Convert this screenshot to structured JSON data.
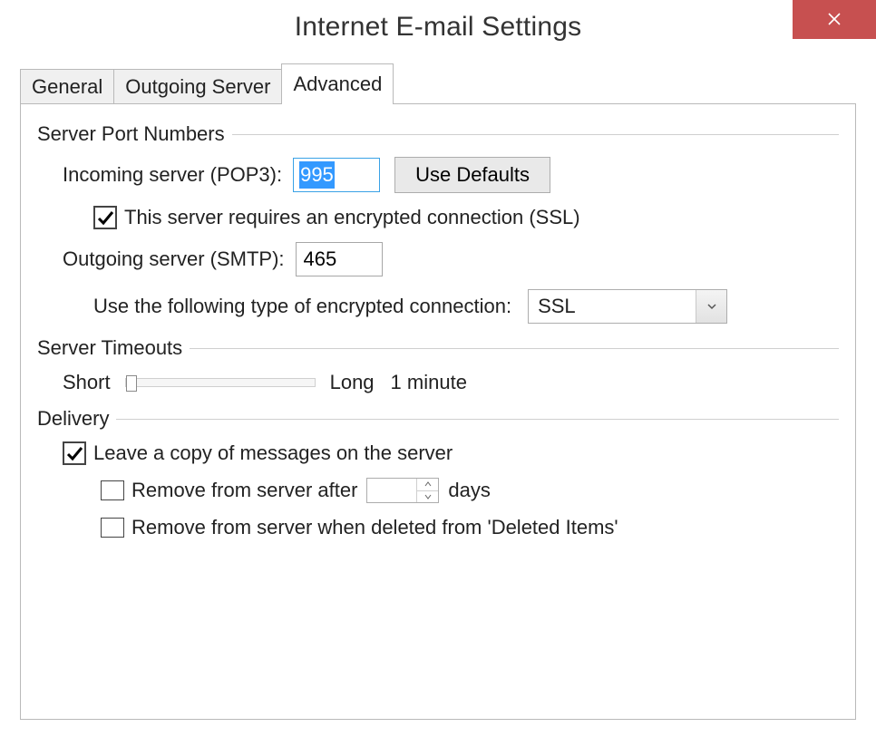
{
  "title": "Internet E-mail Settings",
  "tabs": {
    "general": "General",
    "outgoing": "Outgoing Server",
    "advanced": "Advanced"
  },
  "groups": {
    "server_ports": {
      "header": "Server Port Numbers",
      "incoming_label": "Incoming server (POP3):",
      "incoming_value": "995",
      "use_defaults": "Use Defaults",
      "ssl_checkbox": "This server requires an encrypted connection (SSL)",
      "ssl_checked": true,
      "outgoing_label": "Outgoing server (SMTP):",
      "outgoing_value": "465",
      "enc_type_label": "Use the following type of encrypted connection:",
      "enc_type_value": "SSL"
    },
    "timeouts": {
      "header": "Server Timeouts",
      "short": "Short",
      "long": "Long",
      "value": "1 minute"
    },
    "delivery": {
      "header": "Delivery",
      "leave_copy": "Leave a copy of messages on the server",
      "leave_copy_checked": true,
      "remove_after": "Remove from server after",
      "remove_after_days_label": "days",
      "remove_after_checked": false,
      "remove_after_days_value": "",
      "remove_deleted": "Remove from server when deleted from 'Deleted Items'",
      "remove_deleted_checked": false
    }
  }
}
